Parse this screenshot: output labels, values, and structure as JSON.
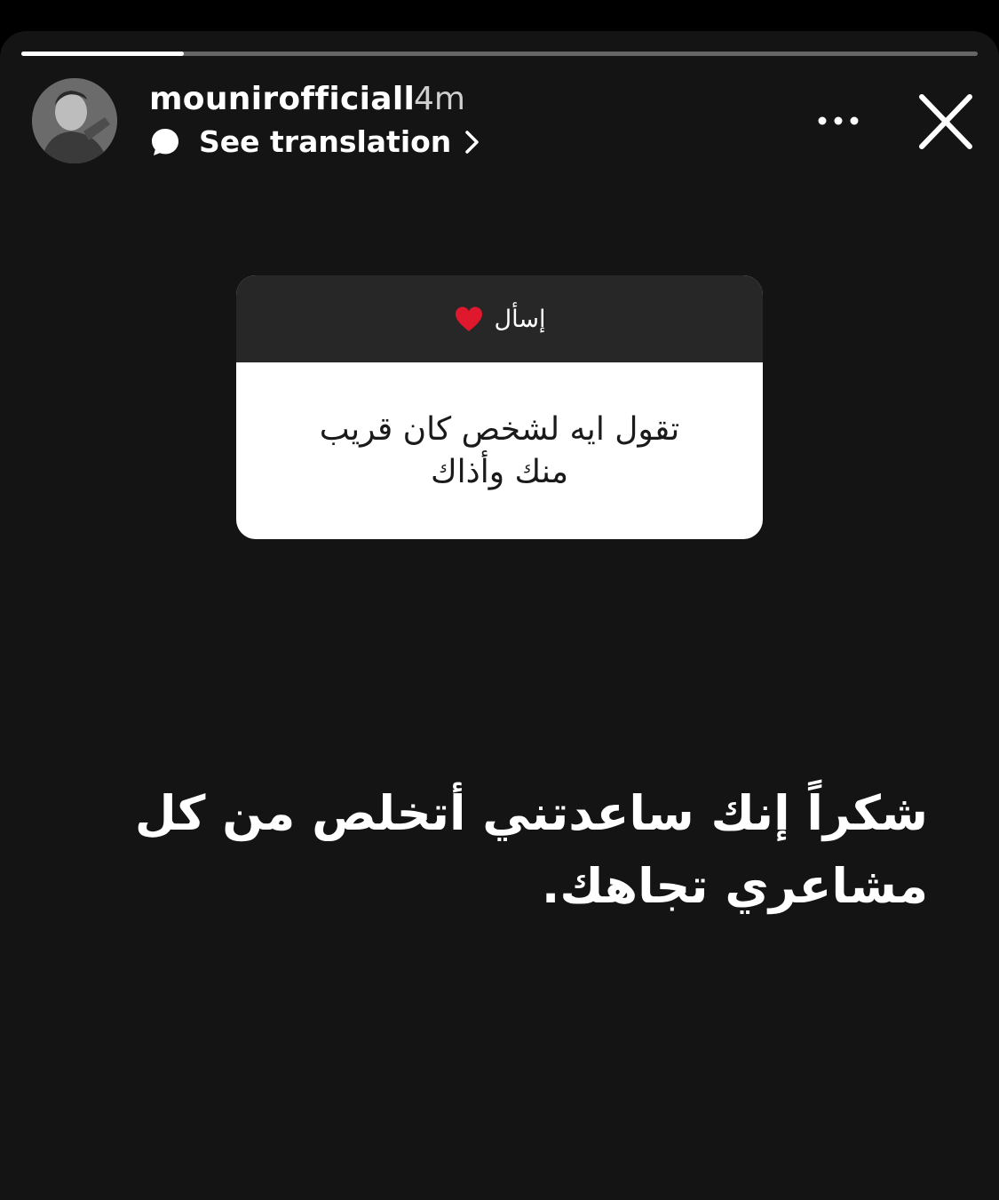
{
  "colors": {
    "background": "#141414",
    "card_header": "#272727",
    "card_body": "#ffffff",
    "text_primary": "#ffffff",
    "heart": "#e0182d"
  },
  "progress": {
    "fraction": 0.17
  },
  "header": {
    "avatar_icon": "profile-photo",
    "username": "mounirofficiall",
    "time": "4m",
    "translation_icon": "speech-bubble-icon",
    "translation_label": "See translation",
    "more_icon": "more-horizontal-icon",
    "close_icon": "close-icon"
  },
  "question_card": {
    "header_label": "إسأل",
    "header_icon": "red-heart-icon",
    "question": "تقول ايه لشخص كان قريب منك وأذاك"
  },
  "answer": {
    "text": "شكراً إنك ساعدتني أتخلص من كل مشاعري تجاهك."
  }
}
